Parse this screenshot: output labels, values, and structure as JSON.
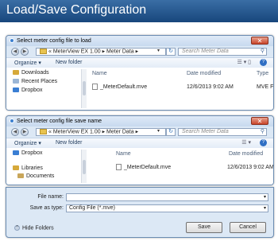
{
  "banner": {
    "title": "Load/Save Configuration"
  },
  "load_dialog": {
    "title": "Select meter config file to load",
    "breadcrumb": "« MeterView EX 1.00 ▸ Meter Data ▸",
    "search_placeholder": "Search Meter Data",
    "organize_label": "Organize ▾",
    "new_folder_label": "New folder",
    "nav_items": [
      "Downloads",
      "Recent Places",
      "Dropbox"
    ],
    "columns": {
      "name": "Name",
      "date": "Date modified",
      "type": "Type"
    },
    "files": [
      {
        "name": "_MeterDefault.mve",
        "date": "12/6/2013 9:02 AM",
        "type": "MVE File"
      }
    ]
  },
  "save_dialog": {
    "title": "Select meter config file save name",
    "breadcrumb": "« MeterView EX 1.00 ▸ Meter Data ▸",
    "search_placeholder": "Search Meter Data",
    "organize_label": "Organize ▾",
    "new_folder_label": "New folder",
    "nav_items": [
      "Dropbox",
      "Libraries",
      "Documents"
    ],
    "columns": {
      "name": "Name",
      "date": "Date modified"
    },
    "files": [
      {
        "name": "_MeterDefault.mve",
        "date": "12/6/2013 9:02 AM"
      }
    ],
    "file_name_label": "File name:",
    "file_name_value": "",
    "save_as_type_label": "Save as type:",
    "save_as_type_value": "Config File (*.mve)",
    "hide_folders_label": "Hide Folders",
    "save_button": "Save",
    "cancel_button": "Cancel"
  }
}
